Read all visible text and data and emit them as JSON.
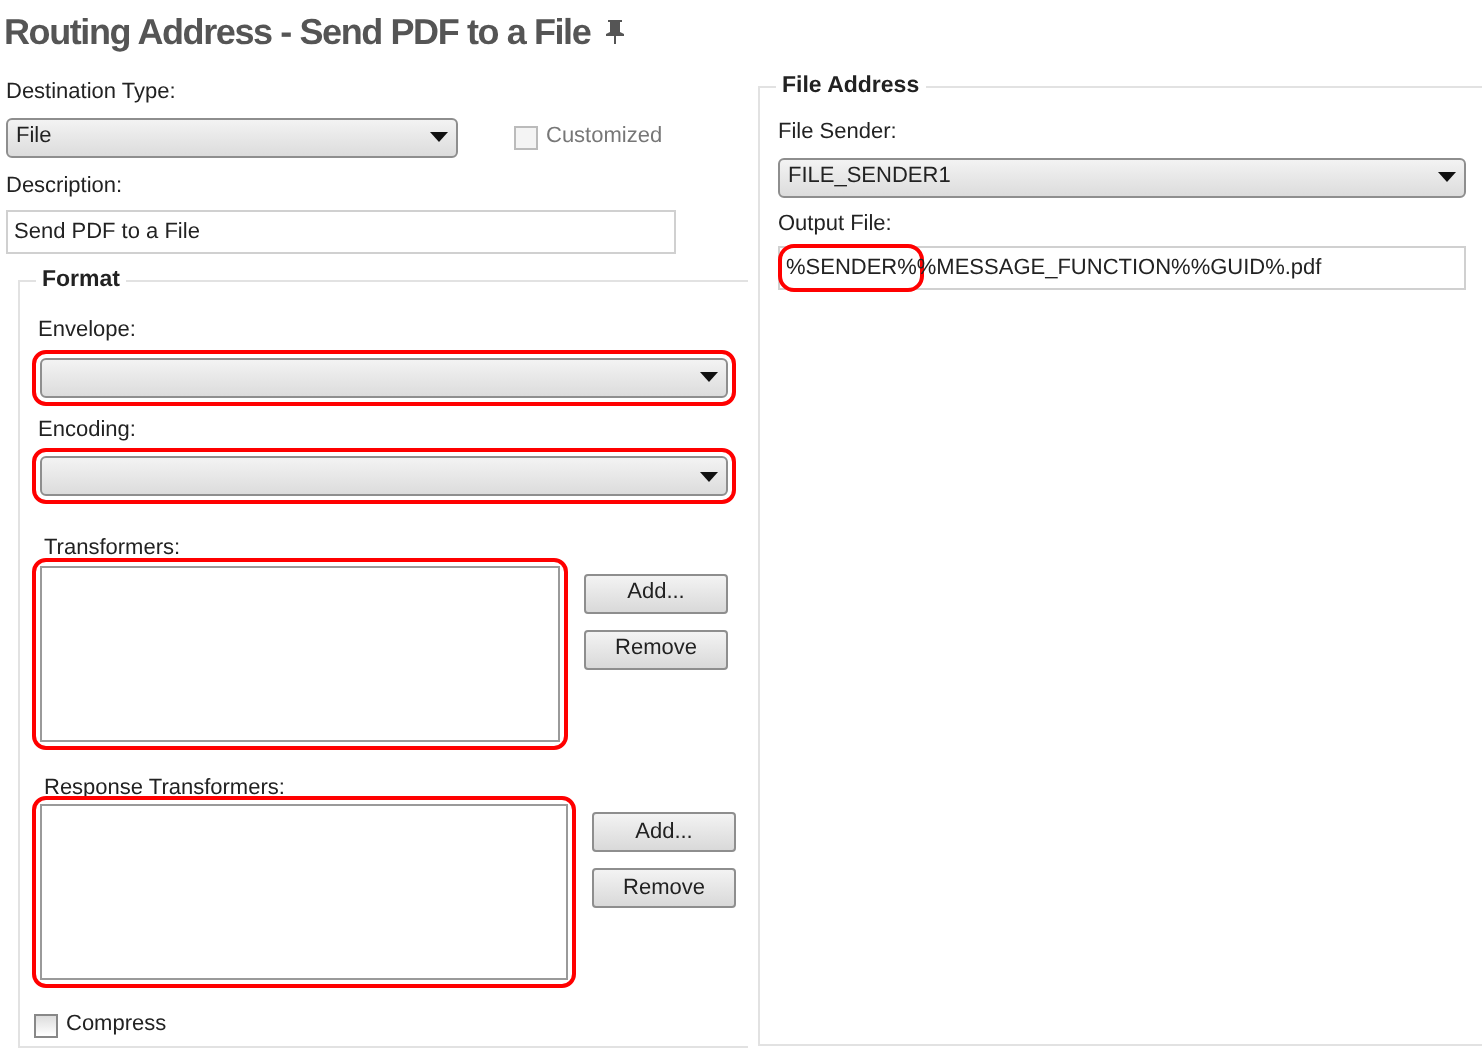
{
  "title": "Routing Address - Send PDF to a File",
  "destination_type": {
    "label": "Destination Type:",
    "value": "File"
  },
  "customized": {
    "label": "Customized",
    "checked": false,
    "disabled": true
  },
  "description": {
    "label": "Description:",
    "value": "Send PDF to a File"
  },
  "format": {
    "legend": "Format",
    "envelope": {
      "label": "Envelope:",
      "highlighted": true
    },
    "encoding": {
      "label": "Encoding:",
      "highlighted": true
    },
    "transformers": {
      "label": "Transformers:",
      "highlighted": true,
      "buttons": [
        "Add...",
        "Remove"
      ]
    },
    "response_transformers": {
      "label": "Response Transformers:",
      "highlighted": true,
      "buttons": [
        "Add...",
        "Remove"
      ]
    },
    "compress": {
      "label": "Compress",
      "checked": false
    }
  },
  "file_address": {
    "legend": "File Address",
    "file_sender": {
      "label": "File Sender:",
      "value": "FILE_SENDER1"
    },
    "output_file": {
      "label": "Output File:",
      "value_parts": [
        {
          "text": "%SENDER%",
          "highlighted": true
        },
        {
          "text": "%MESSAGE_FUNCTION%%GUID%.pdf",
          "highlighted": false
        }
      ]
    }
  }
}
